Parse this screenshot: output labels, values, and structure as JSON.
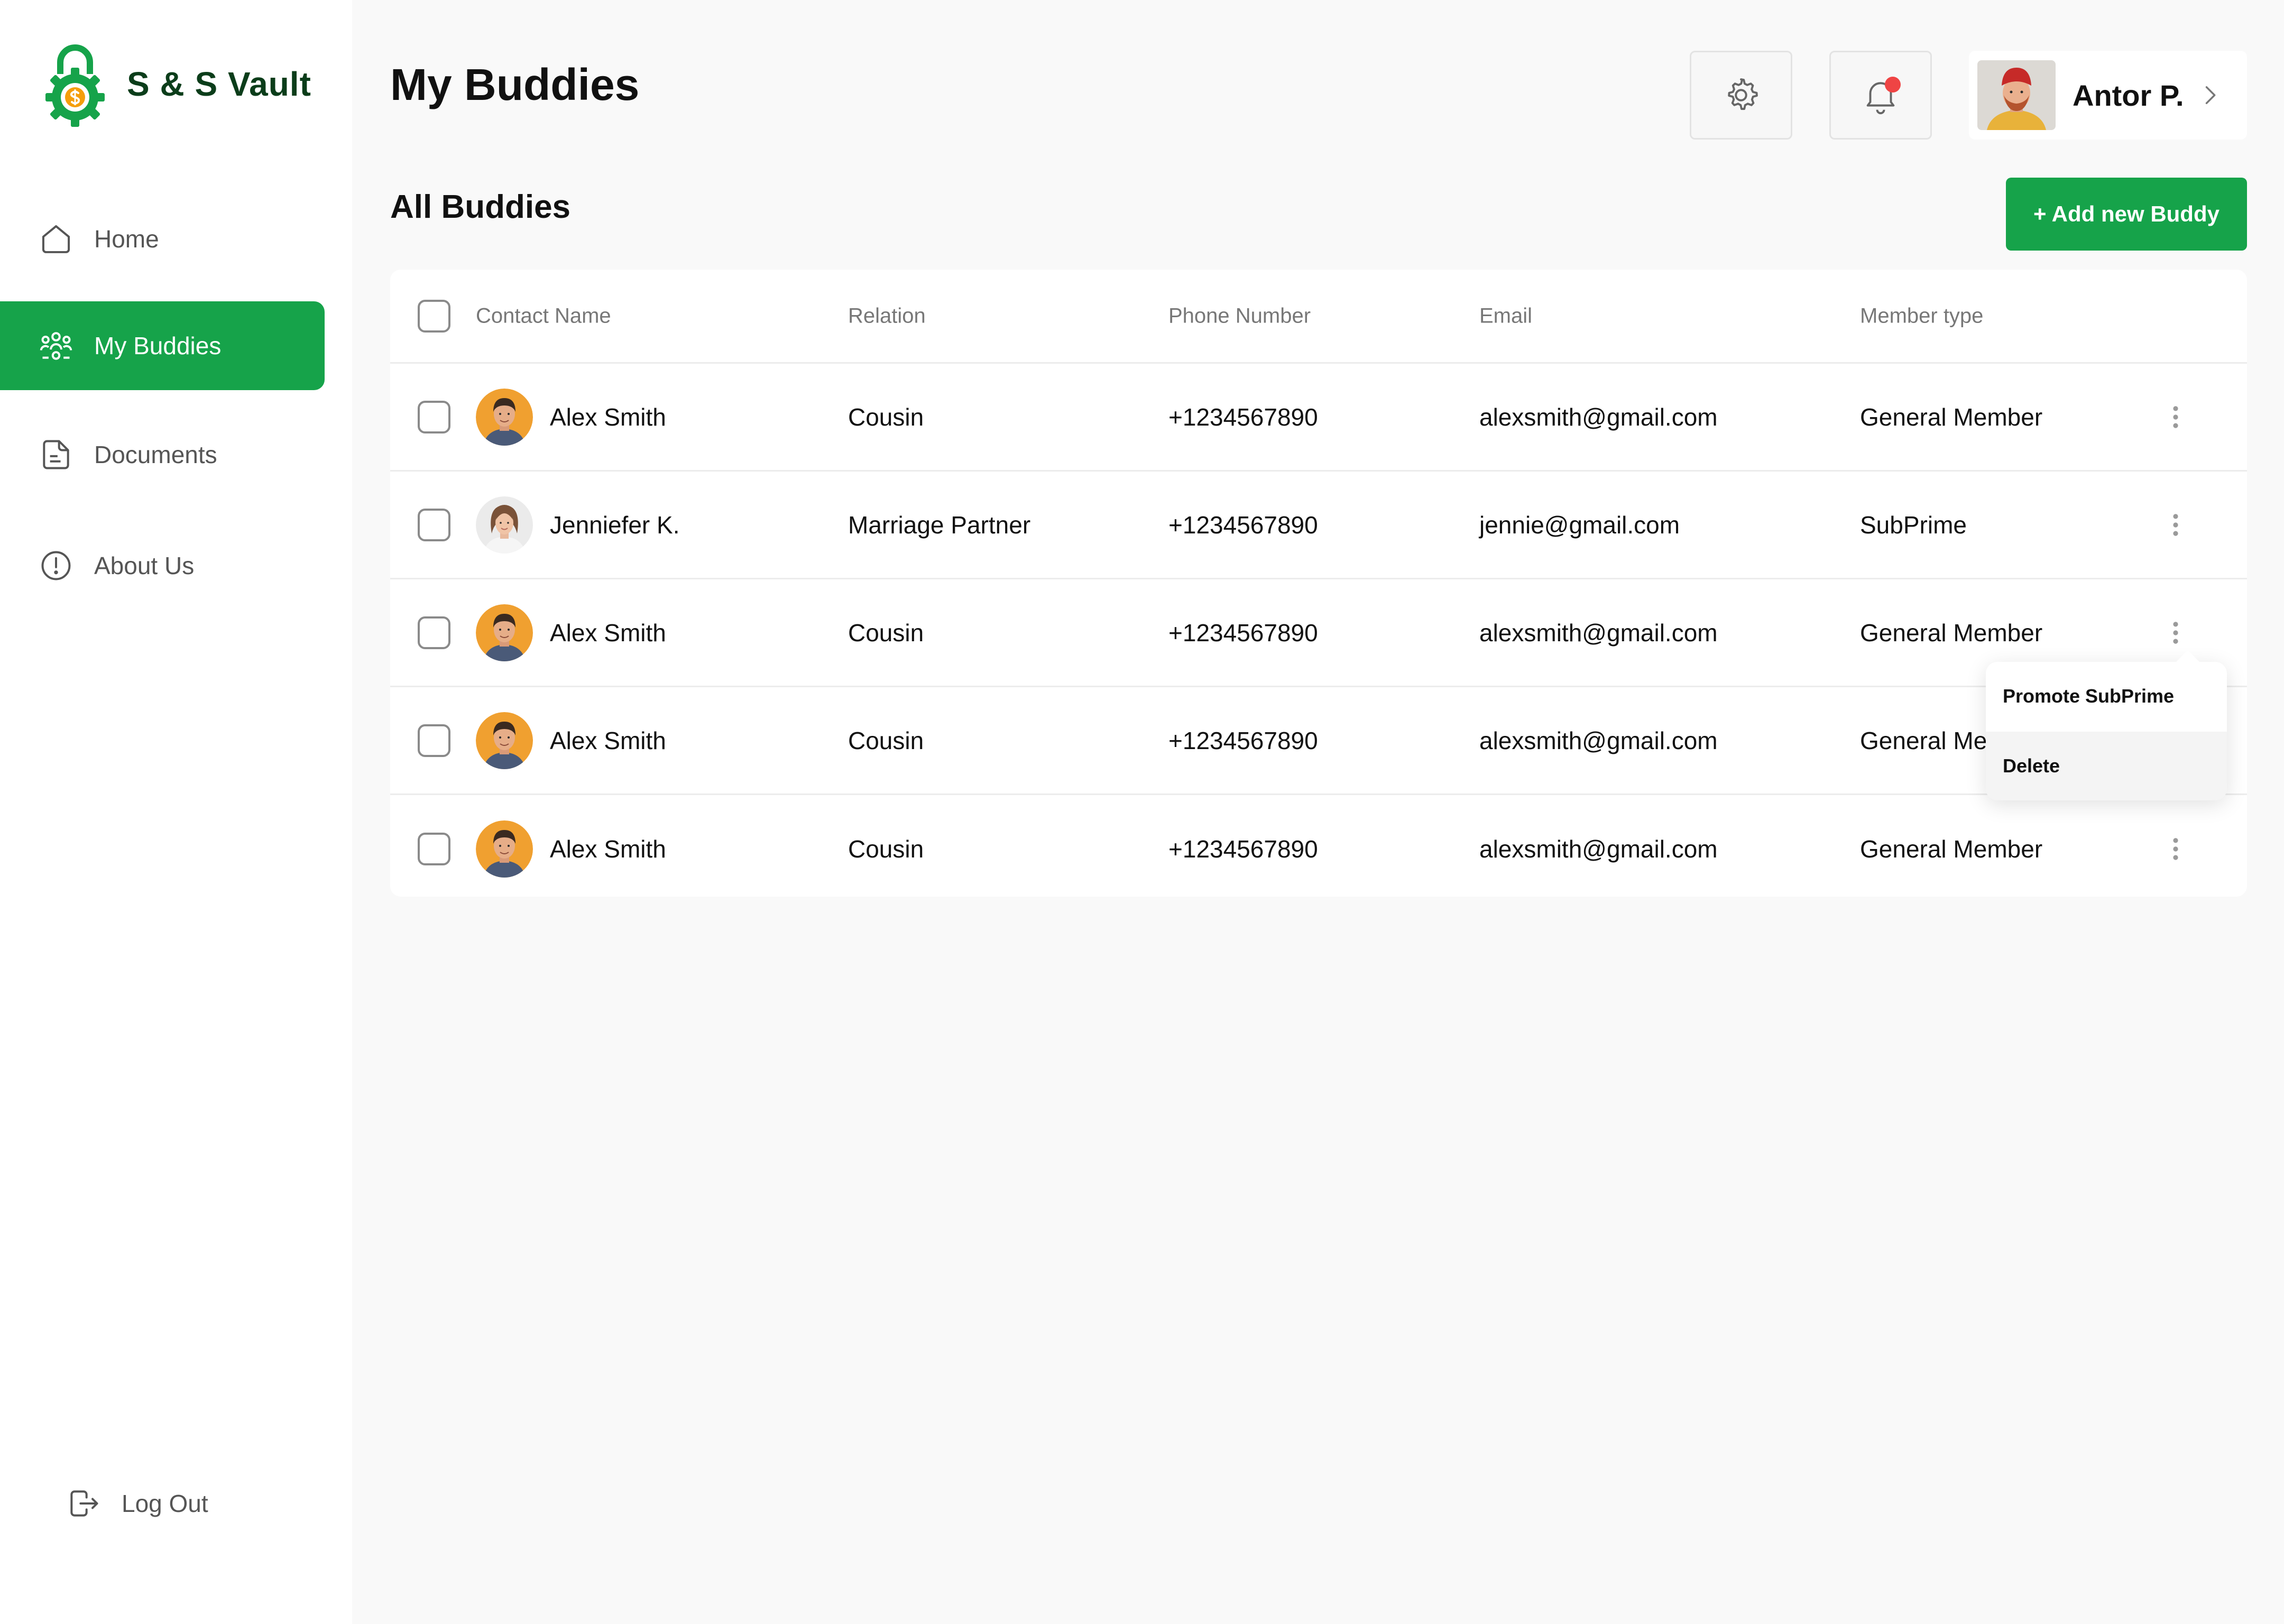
{
  "brand": {
    "name": "S & S Vault",
    "primary_color": "#16a34a",
    "dark_color": "#0b3d1a",
    "accent_color": "#f59e0b"
  },
  "sidebar": {
    "items": [
      {
        "label": "Home",
        "icon": "home-icon"
      },
      {
        "label": "My Buddies",
        "icon": "buddies-icon",
        "active": true
      },
      {
        "label": "Documents",
        "icon": "document-icon"
      },
      {
        "label": "About Us",
        "icon": "info-icon"
      }
    ],
    "logout": {
      "label": "Log Out",
      "icon": "logout-icon"
    }
  },
  "header": {
    "title": "My Buddies",
    "settings_icon": "gear-icon",
    "notification_icon": "bell-icon",
    "notification_dot_color": "#ef4444",
    "user": {
      "name": "Antor P."
    }
  },
  "section": {
    "title": "All Buddies",
    "add_button": "+ Add new Buddy"
  },
  "table": {
    "columns": [
      "Contact Name",
      "Relation",
      "Phone Number",
      "Email",
      "Member type"
    ],
    "rows": [
      {
        "name": "Alex Smith",
        "relation": "Cousin",
        "phone": "+1234567890",
        "email": "alexsmith@gmail.com",
        "member_type": "General Member"
      },
      {
        "name": "Jenniefer K.",
        "relation": "Marriage Partner",
        "phone": "+1234567890",
        "email": "jennie@gmail.com",
        "member_type": "SubPrime"
      },
      {
        "name": "Alex Smith",
        "relation": "Cousin",
        "phone": "+1234567890",
        "email": "alexsmith@gmail.com",
        "member_type": "General Member"
      },
      {
        "name": "Alex Smith",
        "relation": "Cousin",
        "phone": "+1234567890",
        "email": "alexsmith@gmail.com",
        "member_type": "General Member"
      },
      {
        "name": "Alex Smith",
        "relation": "Cousin",
        "phone": "+1234567890",
        "email": "alexsmith@gmail.com",
        "member_type": "General Member"
      }
    ]
  },
  "row_menu": {
    "items": [
      "Promote SubPrime",
      "Delete"
    ]
  }
}
